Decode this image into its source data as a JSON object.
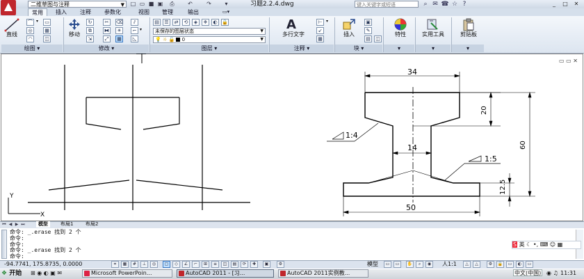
{
  "window": {
    "workspace_name": "二维草图与注释",
    "file_title": "习题2.2.4.dwg",
    "search_placeholder": "键入关键字或短语"
  },
  "ribbon": {
    "tabs": [
      "常用",
      "插入",
      "注释",
      "参数化",
      "视图",
      "管理",
      "输出"
    ],
    "active_tab": "常用",
    "panels": {
      "draw": {
        "title": "绘图",
        "line_label": "直线"
      },
      "modify": {
        "title": "修改",
        "move_label": "移动"
      },
      "layers": {
        "title": "图层",
        "layer_state": "未保存的图层状态",
        "current_layer": "0"
      },
      "annotation": {
        "title": "注释",
        "mtext_label": "多行文字"
      },
      "block": {
        "title": "块",
        "insert_label": "插入"
      },
      "properties": {
        "label": "特性"
      },
      "utilities": {
        "label": "实用工具"
      },
      "clipboard": {
        "label": "剪贴板"
      }
    }
  },
  "drawing": {
    "dim_top": "34",
    "dim_height1": "20",
    "dim_total": "60",
    "dim_web": "14",
    "dim_bottom": "50",
    "dim_flange": "12.5",
    "slope_left": "1:4",
    "slope_right": "1:5",
    "ucs_y": "Y",
    "ucs_x": "X"
  },
  "layout_tabs": [
    "模型",
    "布局1",
    "布局2"
  ],
  "command_history": [
    "命令: _.erase 找到 2 个",
    "命令:",
    "命令:",
    "命令: _.erase 找到 2 个"
  ],
  "command_prompt": "命令:",
  "status": {
    "coords": "-94.7741, 175.8735, 0.0000",
    "model_label": "模型",
    "scale": "人1:1"
  },
  "taskbar": {
    "start_label": "开始",
    "tasks": [
      "Microsoft PowerPoin...",
      "AutoCAD 2011 - [习...",
      "AutoCAD 2011实例教..."
    ],
    "ime": "中文(中国)",
    "clock": "11:31",
    "ime_brand": "英"
  }
}
